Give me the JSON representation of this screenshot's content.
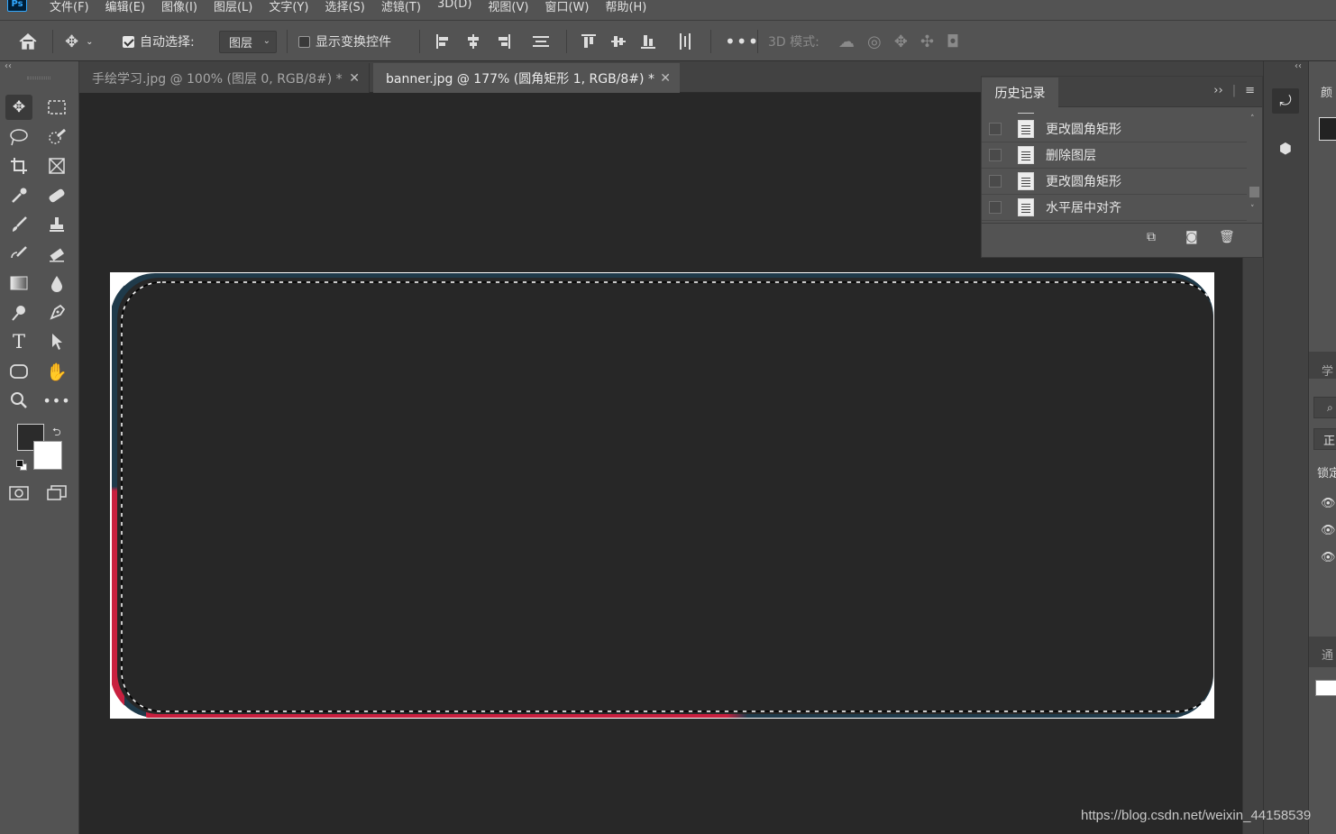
{
  "app": {
    "logo": "Ps"
  },
  "menu": [
    "文件(F)",
    "编辑(E)",
    "图像(I)",
    "图层(L)",
    "文字(Y)",
    "选择(S)",
    "滤镜(T)",
    "3D(D)",
    "视图(V)",
    "窗口(W)",
    "帮助(H)"
  ],
  "options": {
    "auto_select_label": "自动选择:",
    "auto_select_checked": true,
    "auto_select_target": "图层",
    "show_transform_label": "显示变换控件",
    "show_transform_checked": false,
    "three_d_mode_label": "3D 模式:"
  },
  "tabs": [
    {
      "label": "手绘学习.jpg @ 100% (图层 0, RGB/8#) *",
      "active": false
    },
    {
      "label": "banner.jpg @ 177% (圆角矩形 1, RGB/8#) *",
      "active": true
    }
  ],
  "history": {
    "title": "历史记录",
    "items": [
      "更改圆角矩形",
      "删除图层",
      "更改圆角矩形",
      "水平居中对齐"
    ]
  },
  "right_panel": {
    "labels": [
      "颜",
      "学",
      "正",
      "锁定",
      "通"
    ]
  },
  "colors": {
    "foreground": "#2b2b2b",
    "background": "#ffffff",
    "stroke_top": "#1f3a4a",
    "stroke_bottom_left": "#c8203f"
  },
  "watermark": "https://blog.csdn.net/weixin_44158539"
}
